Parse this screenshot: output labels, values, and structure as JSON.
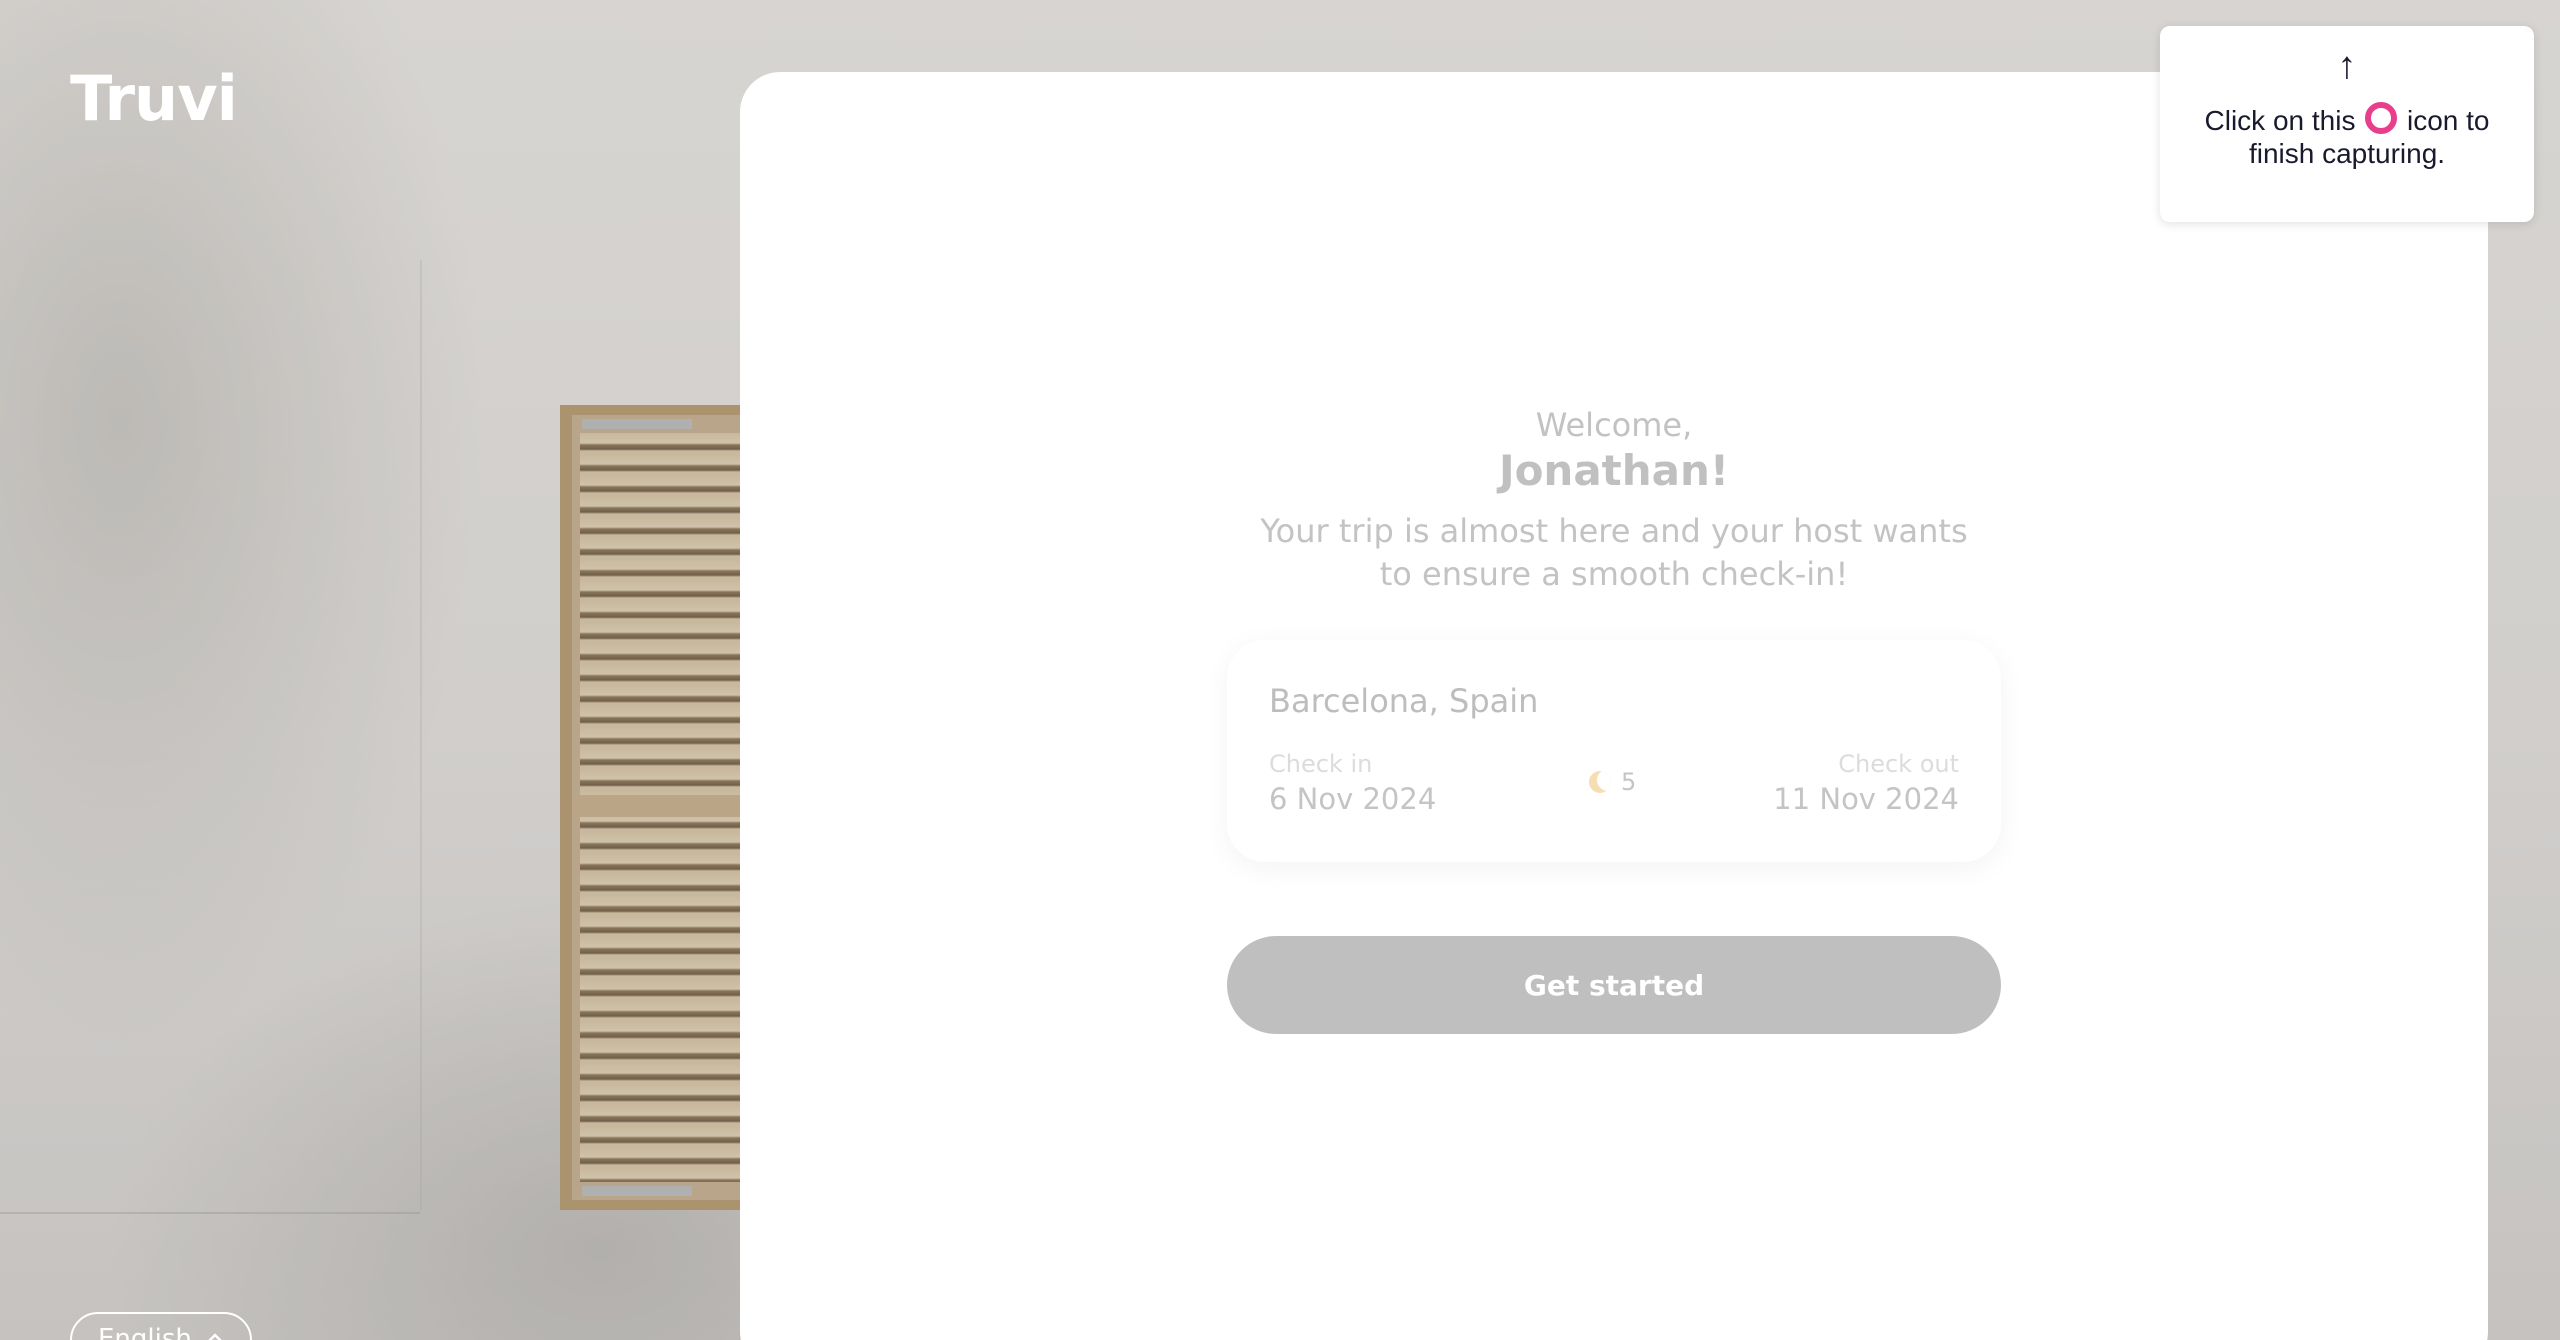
{
  "brand": {
    "logo_text": "Truvi"
  },
  "language": {
    "label": "English"
  },
  "welcome": {
    "greeting": "Welcome,",
    "name": "Jonathan!",
    "subtitle": "Your trip is almost here and your host wants to ensure a smooth check-in!"
  },
  "trip": {
    "location": "Barcelona, Spain",
    "check_in_label": "Check in",
    "check_in_date": "6 Nov 2024",
    "nights": "5",
    "check_out_label": "Check out",
    "check_out_date": "11 Nov 2024"
  },
  "actions": {
    "get_started_label": "Get started"
  },
  "capture_tooltip": {
    "arrow": "↑",
    "text_before": "Click on this",
    "text_after": "icon to finish capturing."
  },
  "colors": {
    "button_bg": "#bfbfbf",
    "record_icon": "#e83e8c",
    "moon_icon": "#f6deb3"
  }
}
